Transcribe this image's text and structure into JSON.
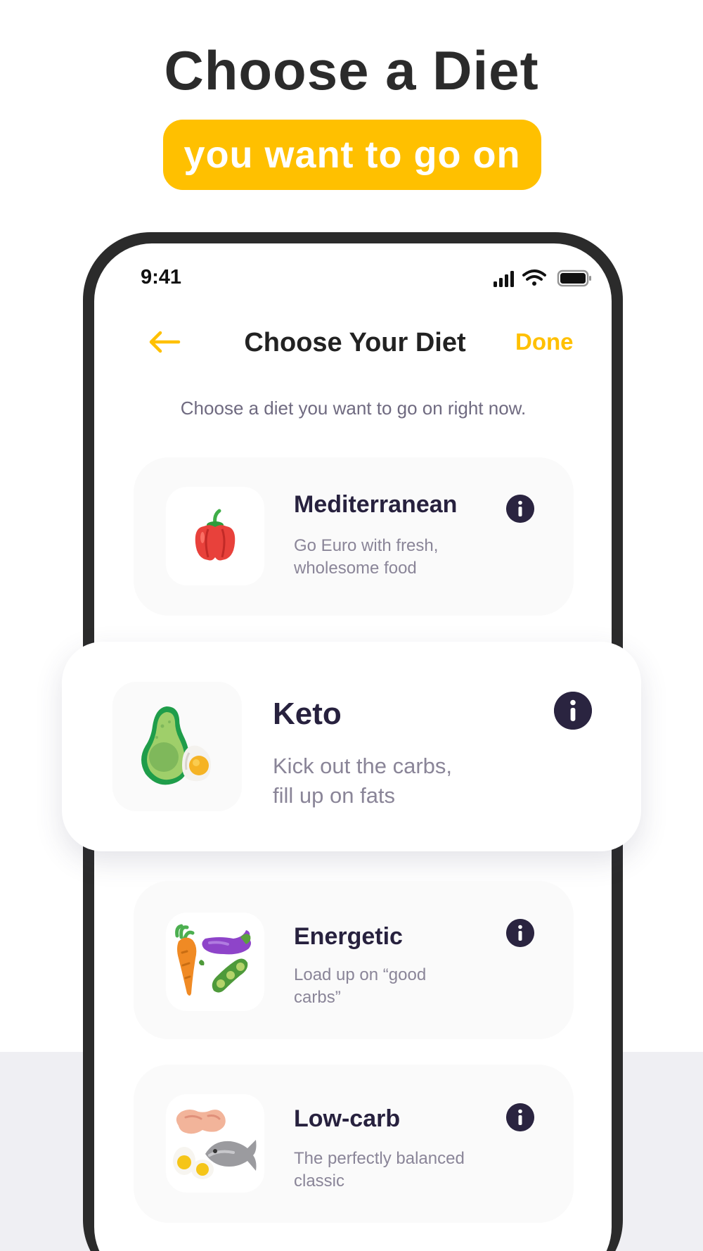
{
  "hero": {
    "title": "Choose a Diet",
    "highlight": "you want to go on",
    "highlight_color": "#FFC000"
  },
  "status_bar": {
    "time": "9:41",
    "icons": [
      "signal-icon",
      "wifi-icon",
      "battery-icon"
    ]
  },
  "nav": {
    "back_icon": "arrow-left-icon",
    "title": "Choose Your Diet",
    "done_label": "Done"
  },
  "subtitle": "Choose a diet you want to go on right now.",
  "diets": [
    {
      "name": "Mediterranean",
      "desc_line1": "Go Euro with fresh,",
      "desc_line2": "wholesome food",
      "icon": "bell-pepper-icon",
      "selected": false
    },
    {
      "name": "Keto",
      "desc_line1": "Kick out the carbs,",
      "desc_line2": "fill up on fats",
      "icon": "avocado-egg-icon",
      "selected": true
    },
    {
      "name": "Energetic",
      "desc_line1": "Load up on “good",
      "desc_line2": "carbs”",
      "icon": "vegetables-icon",
      "selected": false
    },
    {
      "name": "Low-carb",
      "desc_line1": "The perfectly balanced",
      "desc_line2": "classic",
      "icon": "egg-fish-peanut-icon",
      "selected": false
    }
  ],
  "colors": {
    "accent": "#FFC000",
    "dark": "#2A2440",
    "muted_text": "#8A8598"
  }
}
